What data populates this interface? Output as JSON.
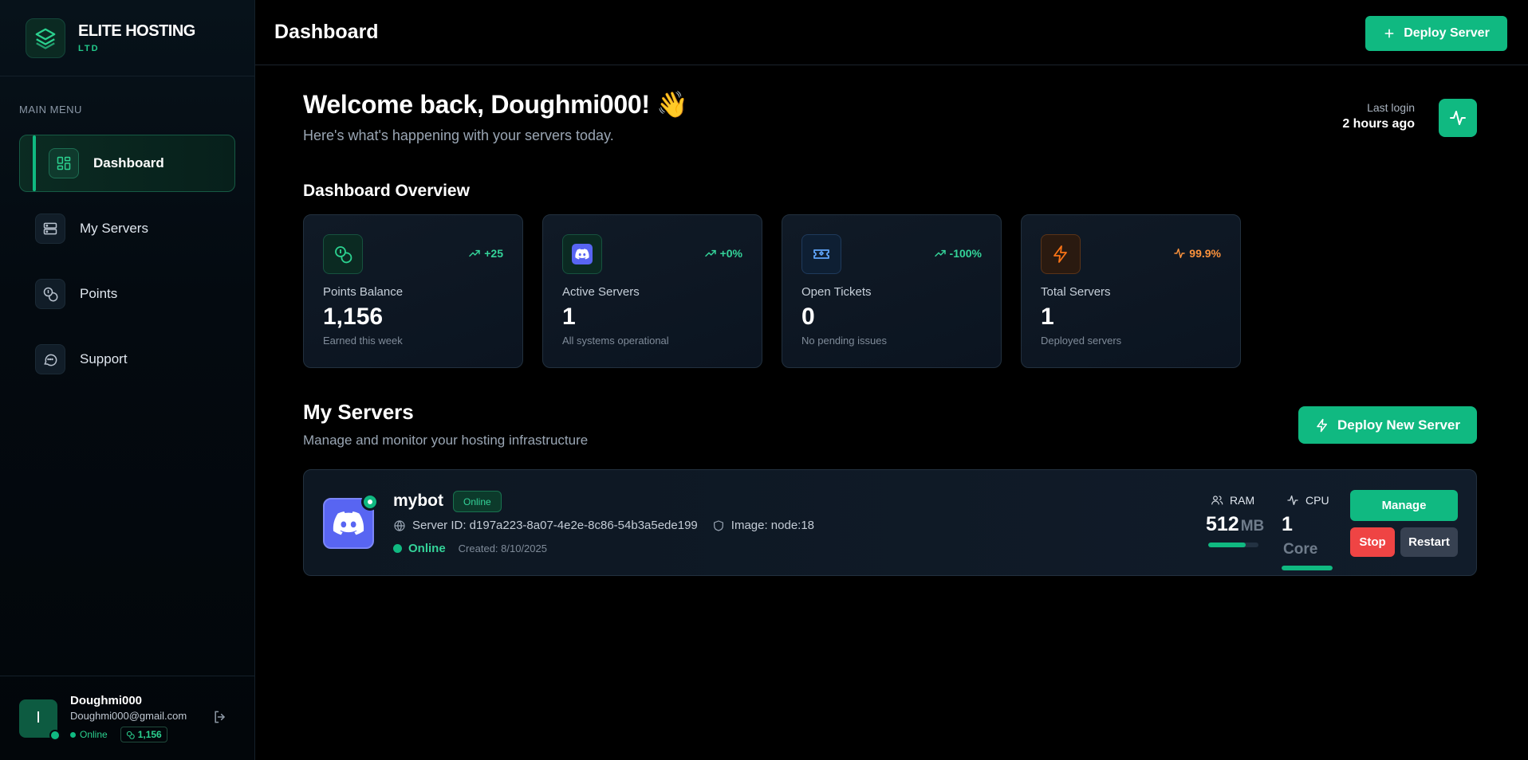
{
  "brand": {
    "name": "ELITE HOSTING",
    "sub": "LTD"
  },
  "sidebar": {
    "menu_title": "MAIN MENU",
    "items": [
      {
        "label": "Dashboard",
        "icon": "dashboard-icon",
        "active": true
      },
      {
        "label": "My Servers",
        "icon": "servers-icon"
      },
      {
        "label": "Points",
        "icon": "coins-icon"
      },
      {
        "label": "Support",
        "icon": "chat-icon"
      }
    ]
  },
  "user": {
    "initial": "I",
    "name": "Doughmi000",
    "email": "Doughmi000@gmail.com",
    "status": "Online",
    "points": "1,156"
  },
  "topbar": {
    "title": "Dashboard",
    "deploy_label": "Deploy Server"
  },
  "welcome": {
    "title": "Welcome back, Doughmi000! 👋",
    "subtitle": "Here's what's happening with your servers today.",
    "last_login_label": "Last login",
    "last_login_value": "2 hours ago"
  },
  "overview": {
    "title": "Dashboard Overview",
    "cards": [
      {
        "label": "Points Balance",
        "value": "1,156",
        "desc": "Earned this week",
        "trend": "+25",
        "icon": "coins-icon",
        "accent": "#10b981"
      },
      {
        "label": "Active Servers",
        "value": "1",
        "desc": "All systems operational",
        "trend": "+0%",
        "icon": "discord-icon",
        "accent": "#10b981"
      },
      {
        "label": "Open Tickets",
        "value": "0",
        "desc": "No pending issues",
        "trend": "-100%",
        "icon": "ticket-icon",
        "accent": "#10b981"
      },
      {
        "label": "Total Servers",
        "value": "1",
        "desc": "Deployed servers",
        "trend": "99.9%",
        "icon": "bolt-icon",
        "accent": "#f97316"
      }
    ]
  },
  "servers": {
    "title": "My Servers",
    "subtitle": "Manage and monitor your hosting infrastructure",
    "deploy_label": "Deploy New Server",
    "list": [
      {
        "name": "mybot",
        "badge": "Online",
        "server_id": "Server ID: d197a223-8a07-4e2e-8c86-54b3a5ede199",
        "image": "Image: node:18",
        "status": "Online",
        "created": "Created: 8/10/2025",
        "ram_label": "RAM",
        "ram_value": "512",
        "ram_unit": "MB",
        "ram_fraction": 0.75,
        "cpu_label": "CPU",
        "cpu_value": "1",
        "cpu_unit": "Core",
        "cpu_fraction": 1.0,
        "manage_label": "Manage",
        "stop_label": "Stop",
        "restart_label": "Restart"
      }
    ]
  }
}
